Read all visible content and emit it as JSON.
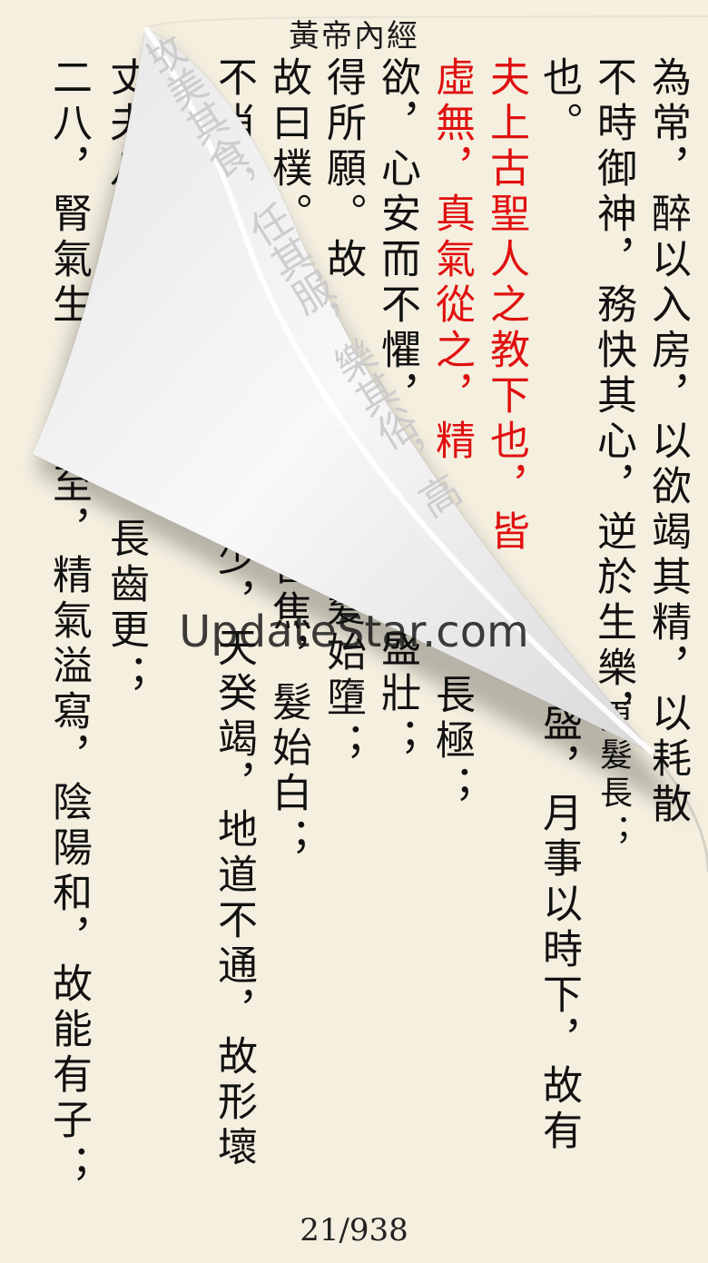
{
  "header": {
    "title": "黃帝內經"
  },
  "footer": {
    "page_indicator": "21/938"
  },
  "watermark": {
    "text": "UpdateStar.com"
  },
  "columns": [
    {
      "text": "為常，醉以入房，以欲竭其精，以耗散",
      "color": "#111111"
    },
    {
      "text": "不時御神，務快其心，逆於生樂，",
      "color": "#111111"
    },
    {
      "text": "也。",
      "color": "#111111"
    },
    {
      "text": "夫上古聖人之教下也，皆",
      "color": "#e01010"
    },
    {
      "text": "虛無，真氣從之，精",
      "color": "#e01010"
    },
    {
      "text": "欲，心安而不懼，",
      "color": "#111111"
    },
    {
      "text": "得所願。故",
      "color": "#111111"
    },
    {
      "text": "故曰樸。",
      "color": "#111111"
    },
    {
      "text": "不肖",
      "color": "#111111"
    },
    {
      "text": "丈夫八歲",
      "color": "#111111"
    },
    {
      "text": "二八，腎氣生，",
      "color": "#111111"
    }
  ],
  "lower_columns": [
    {
      "text": "盛，月事以時下，故有",
      "color": "#111111"
    },
    {
      "text": "更髮長；",
      "color": "#111111"
    },
    {
      "text": "長極；",
      "color": "#111111"
    },
    {
      "text": "盛壯；",
      "color": "#111111"
    },
    {
      "text": "髮始墮；",
      "color": "#111111"
    },
    {
      "text": "皆焦，髮始白；",
      "color": "#111111"
    },
    {
      "text": "少，天癸竭，地道不通，故形壞",
      "color": "#111111"
    },
    {
      "text": "長齒更；",
      "color": "#111111"
    },
    {
      "text": "至，精氣溢寫，陰陽和，故能有子；",
      "color": "#111111"
    }
  ],
  "curl_back_text": "故美其食，任其服，樂其俗，高下不相慕，其民故曰樸。是以嗜欲不能勞其目，淫邪不能惑其心"
}
